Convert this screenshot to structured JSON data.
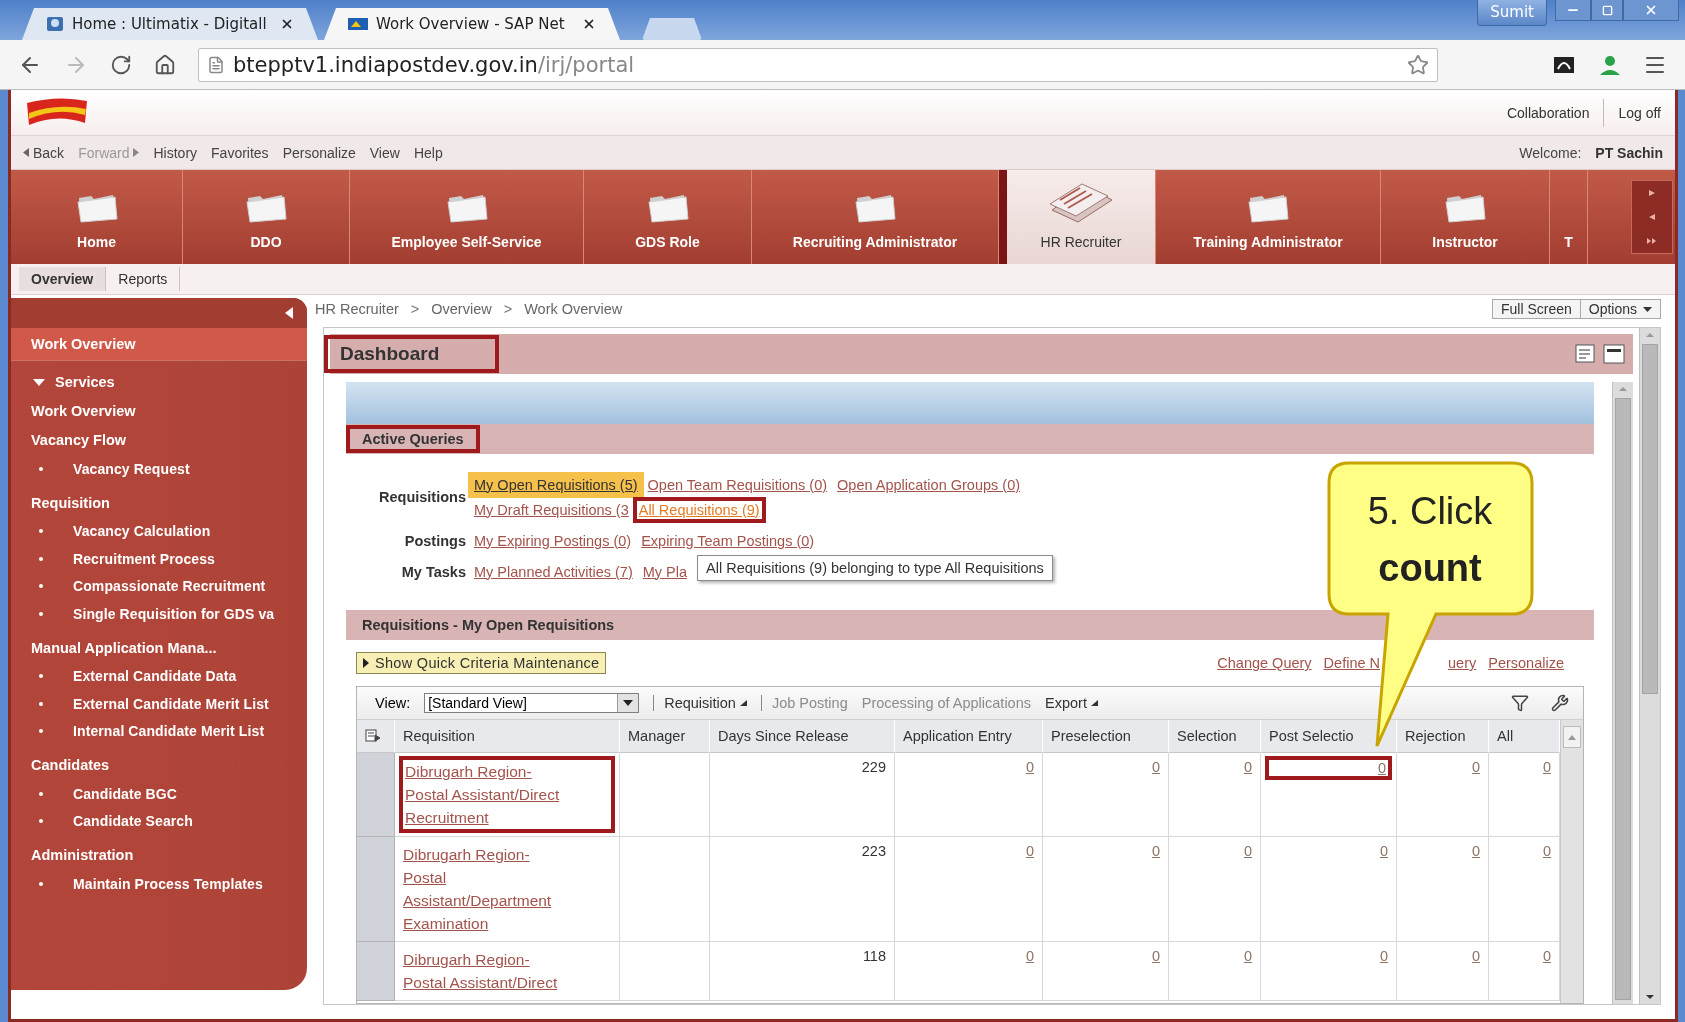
{
  "browser": {
    "tabs": [
      {
        "title": "Home : Ultimatix - Digitall",
        "selected": false
      },
      {
        "title": "Work Overview - SAP Net",
        "selected": true
      }
    ],
    "profile": "Sumit",
    "url_host": "btepptv1.indiapostdev.gov.in",
    "url_path": "/irj/portal"
  },
  "portal": {
    "header_links": [
      "Collaboration",
      "Log off"
    ],
    "nav_links": [
      {
        "label": "Back",
        "kind": "back",
        "disabled": false
      },
      {
        "label": "Forward",
        "kind": "forward",
        "disabled": true
      },
      {
        "label": "History",
        "kind": "plain",
        "disabled": false
      },
      {
        "label": "Favorites",
        "kind": "plain",
        "disabled": false
      },
      {
        "label": "Personalize",
        "kind": "plain",
        "disabled": false
      },
      {
        "label": "View",
        "kind": "plain",
        "disabled": false
      },
      {
        "label": "Help",
        "kind": "plain",
        "disabled": false
      }
    ],
    "welcome_label": "Welcome:",
    "user": "PT Sachin"
  },
  "top_tabs": [
    {
      "label": "Home",
      "selected": false
    },
    {
      "label": "DDO",
      "selected": false
    },
    {
      "label": "Employee Self-Service",
      "selected": false
    },
    {
      "label": "GDS Role",
      "selected": false
    },
    {
      "label": "Recruiting Administrator",
      "selected": false
    },
    {
      "label": "HR Recruiter",
      "selected": true
    },
    {
      "label": "Training Administrator",
      "selected": false
    },
    {
      "label": "Instructor",
      "selected": false
    },
    {
      "label": "T",
      "selected": false
    }
  ],
  "sub_tabs": [
    {
      "label": "Overview",
      "selected": true
    },
    {
      "label": "Reports",
      "selected": false
    }
  ],
  "sidebar": {
    "items": [
      {
        "label": "Work Overview",
        "selected": true
      }
    ],
    "folder": {
      "label": "Services",
      "expanded": true,
      "sections": [
        {
          "label": "Work Overview"
        },
        {
          "label": "Vacancy Flow",
          "children": [
            "Vacancy Request"
          ]
        },
        {
          "label": "Requisition",
          "children": [
            "Vacancy Calculation",
            "Recruitment Process",
            "Compassionate Recruitment",
            "Single Requisition for GDS va"
          ]
        },
        {
          "label": "Manual Application Mana...",
          "children": [
            "External Candidate Data",
            "External Candidate Merit List",
            "Internal Candidate Merit List"
          ]
        },
        {
          "label": "Candidates",
          "children": [
            "Candidate BGC",
            "Candidate Search"
          ]
        },
        {
          "label": "Administration",
          "children": [
            "Maintain Process Templates"
          ]
        }
      ]
    }
  },
  "breadcrumb": [
    {
      "text": "HR Recruiter",
      "kind": "link"
    },
    {
      "text": ">",
      "kind": "separator"
    },
    {
      "text": "Overview",
      "kind": "link"
    },
    {
      "text": ">",
      "kind": "separator"
    },
    {
      "text": "Work Overview",
      "kind": "link"
    }
  ],
  "page_actions": [
    {
      "label": "Full Screen",
      "kind": "button"
    },
    {
      "label": "Options",
      "kind": "menu"
    }
  ],
  "dashboard": {
    "title": "Dashboard",
    "highlighted": true
  },
  "active_queries": {
    "title": "Active Queries",
    "highlighted": true,
    "groups": [
      {
        "label": "Requisitions",
        "lines": [
          [
            {
              "text": "My Open Requisitions (5)",
              "selected": true,
              "hovered": false,
              "highlighted": false
            },
            {
              "text": "Open Team Requisitions (0)",
              "selected": false,
              "hovered": false,
              "highlighted": false
            },
            {
              "text": "Open Application Groups (0)",
              "selected": false,
              "hovered": false,
              "highlighted": false
            }
          ],
          [
            {
              "text": "My Draft Requisitions (3",
              "selected": false,
              "hovered": false,
              "highlighted": false
            },
            {
              "text": "All Requisitions (9)",
              "selected": false,
              "hovered": true,
              "highlighted": true
            }
          ]
        ]
      },
      {
        "label": "Postings",
        "lines": [
          [
            {
              "text": "My Expiring Postings (0)",
              "selected": false,
              "hovered": false,
              "highlighted": false
            },
            {
              "text": "Expiring Team Postings (0)",
              "selected": false,
              "hovered": false,
              "highlighted": false
            }
          ]
        ]
      },
      {
        "label": "My Tasks",
        "lines": [
          [
            {
              "text": "My Planned Activities (7)",
              "selected": false,
              "hovered": false,
              "highlighted": false
            },
            {
              "text": "My Pla",
              "selected": false,
              "hovered": false,
              "highlighted": false,
              "tooltip": "All Requisitions (9) belonging to type All Requisitions"
            }
          ]
        ]
      }
    ]
  },
  "requisitions": {
    "title": "Requisitions - My Open Requisitions",
    "criteria_button": "Show Quick Criteria Maintenance",
    "links": [
      {
        "text": "Change Query",
        "kind": "link"
      },
      {
        "text": "Define N",
        "kind": "link"
      },
      {
        "kind": "covered"
      },
      {
        "text": "uery",
        "kind": "link"
      },
      {
        "text": "Personalize",
        "kind": "link"
      }
    ],
    "view_label": "View:",
    "view_value": "[Standard View]",
    "toolbar": [
      {
        "label": "Requisition",
        "kind": "menu",
        "disabled": false
      },
      {
        "label": "Job Posting",
        "kind": "action",
        "disabled": true
      },
      {
        "label": "Processing of Applications",
        "kind": "action",
        "disabled": true
      },
      {
        "label": "Export",
        "kind": "menu",
        "disabled": false
      }
    ],
    "columns": [
      "Requisition",
      "Manager",
      "Days Since Release",
      "Application Entry",
      "Preselection",
      "Selection",
      "Post Selectio",
      "Rejection",
      "All"
    ],
    "rows": [
      {
        "requisition": "Dibrugarh Region- Postal Assistant/Direct Recruitment",
        "highlighted": true,
        "manager": "",
        "days": "229",
        "counts": [
          {
            "text": "0",
            "highlighted": false
          },
          {
            "text": "0",
            "highlighted": false
          },
          {
            "text": "0",
            "highlighted": false
          },
          {
            "text": "0",
            "highlighted": true
          },
          {
            "text": "0",
            "highlighted": false
          },
          {
            "text": "0",
            "highlighted": false
          }
        ]
      },
      {
        "requisition": "Dibrugarh Region- Postal Assistant/Department Examination",
        "highlighted": false,
        "manager": "",
        "days": "223",
        "counts": [
          {
            "text": "0",
            "highlighted": false
          },
          {
            "text": "0",
            "highlighted": false
          },
          {
            "text": "0",
            "highlighted": false
          },
          {
            "text": "0",
            "highlighted": false
          },
          {
            "text": "0",
            "highlighted": false
          },
          {
            "text": "0",
            "highlighted": false
          }
        ]
      },
      {
        "requisition": "Dibrugarh Region- Postal Assistant/Direct",
        "highlighted": false,
        "manager": "",
        "days": "118",
        "counts": [
          {
            "text": "0",
            "highlighted": false
          },
          {
            "text": "0",
            "highlighted": false
          },
          {
            "text": "0",
            "highlighted": false
          },
          {
            "text": "0",
            "highlighted": false
          },
          {
            "text": "0",
            "highlighted": false
          },
          {
            "text": "0",
            "highlighted": false
          }
        ]
      }
    ]
  },
  "callout": {
    "lines": [
      {
        "text": "5. Click",
        "bold": false
      },
      {
        "text": "count",
        "bold": true
      }
    ]
  }
}
